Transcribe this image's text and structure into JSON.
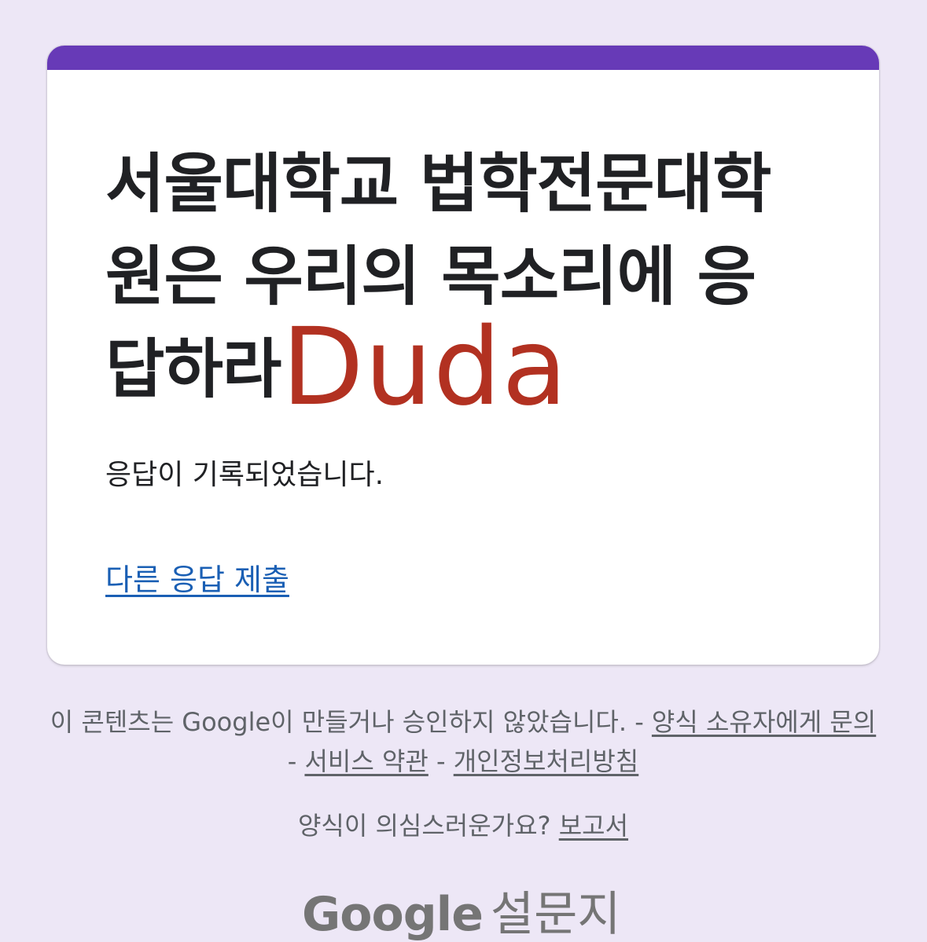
{
  "form": {
    "title": "서울대학교 법학전문대학원은 우리의 목소리에 응답하라",
    "confirmation_message": "응답이 기록되었습니다.",
    "submit_another_link": "다른 응답 제출",
    "accent_color": "#673ab7"
  },
  "overlay": {
    "text": "Duda",
    "color": "#b23121"
  },
  "footer": {
    "disclaimer": "이 콘텐츠는 Google이 만들거나 승인하지 않았습니다.",
    "separator": "-",
    "contact_owner_link": "양식 소유자에게 문의",
    "terms_link": "서비스 약관",
    "privacy_link": "개인정보처리방침",
    "suspicious_question": "양식이 의심스러운가요?",
    "report_link": "보고서"
  },
  "brand": {
    "logo": "Google",
    "product": "설문지"
  },
  "colors": {
    "background": "#ede7f6",
    "link": "#1a5fb4",
    "footer_text": "#5f6368"
  }
}
